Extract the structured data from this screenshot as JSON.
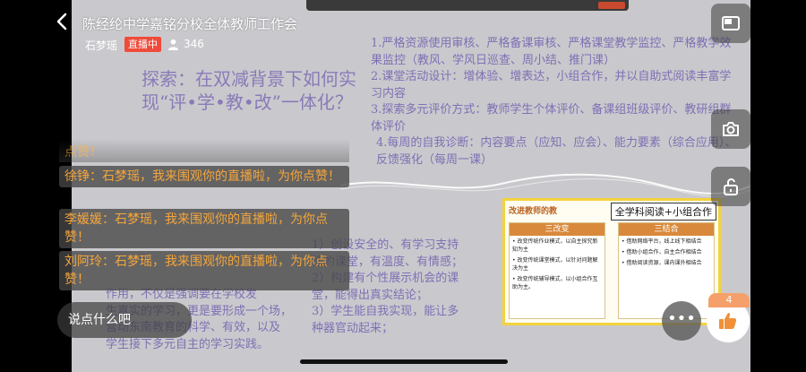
{
  "header": {
    "title": "陈经纶中学嘉铭分校全体教师工作会",
    "host": "石梦瑶",
    "live_badge": "直播中",
    "viewers": "346"
  },
  "slide": {
    "title": "探索：在双减背景下如何实现“评•学•教•改”一体化？",
    "points": [
      "1.严格资源使用审核、严格备课审核、严格课堂教学监控、严格教学效果监控（教风、学风日巡查、周小结、推门课）",
      "2.课堂活动设计：增体验、增表达，小组合作，并以自助式阅读丰富学习内容",
      "3.探索多元评价方式：教师学生个体评价、备课组班级评价、教研组群体评价",
      "4.每周的自我诊断：内容要点（应知、应会）、能力要素（综合应用）、反馈强化（每周一课）"
    ],
    "lower_left": [
      "作用，不仅是强调要在学校发",
      "生真实的学习，更是要形成一个场，",
      "营动东南教育的科学、有效，以及",
      "学生接下多元自主的学习实践。"
    ],
    "lower_right": [
      "1）创设安全的、有学习支持",
      "性的课堂，有温度、有情感；",
      "2）构建有个性展示机会的课",
      "堂，能得出真实结论；",
      "3）学生能自我实现，能让多",
      "种器官动起来；"
    ],
    "card": {
      "head_left": "改进教师的教",
      "head_right": "全学科阅读+小组合作",
      "left_col_title": "三改变",
      "left_items": [
        "• 改变传统作业模式，以自主探究新知为主",
        "• 改变传统课堂模式，以针对问题解决为主",
        "• 改变传统辅导模式，以小组合作互助为主。"
      ],
      "right_col_title": "三结合",
      "right_items": [
        "• 借助网络平台，线上线下相结合",
        "• 借助小组合作，自主合作相结合",
        "• 借助阅读资源，课内课外相结合"
      ]
    }
  },
  "comments": {
    "faded": "点赞！",
    "items": [
      {
        "user": "徐铮",
        "message": "：石梦瑶，我来围观你的直播啦，为你点赞！"
      },
      {
        "user": "李媛媛",
        "message": "：石梦瑶，我来围观你的直播啦，为你点赞！"
      },
      {
        "user": "刘阿玲",
        "message": "：石梦瑶，我来围观你的直播啦，为你点赞！"
      }
    ]
  },
  "bottom": {
    "say_placeholder": "说点什么吧",
    "more_label": "•••",
    "like_count": "4"
  },
  "icons": {
    "back": "chevron-left-icon",
    "viewer": "person-icon",
    "pip": "picture-in-picture-icon",
    "camera": "camera-icon",
    "lock": "unlock-icon",
    "like": "thumbs-up-icon"
  },
  "colors": {
    "live_badge": "#f04a3a",
    "comment_text": "#f5a63a",
    "slide_text": "#7f6fb4",
    "like_badge": "#f5a06a"
  }
}
